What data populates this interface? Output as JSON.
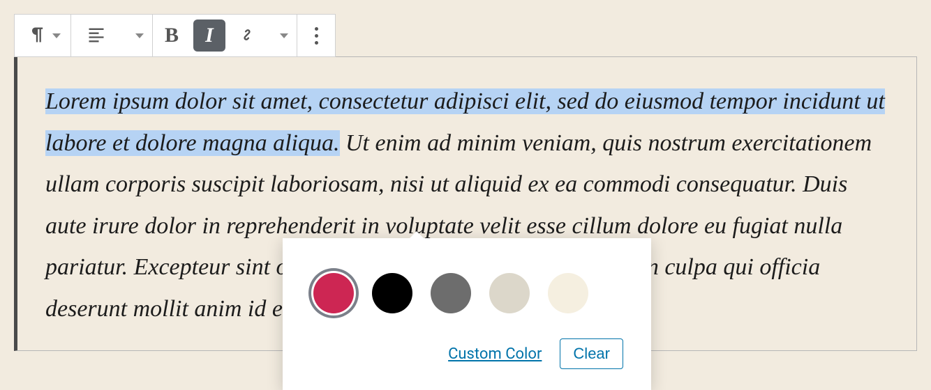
{
  "paragraph": {
    "highlighted": "Lorem ipsum dolor sit amet, consectetur adipisci elit, sed do eiusmod tempor incidunt ut labore et dolore magna aliqua.",
    "rest": " Ut enim ad minim veniam, quis nostrum exercitationem ullam corporis suscipit laboriosam, nisi ut aliquid ex ea commodi consequatur. Duis aute irure dolor in reprehenderit in voluptate velit esse cillum dolore eu fugiat nulla pariatur. Excepteur sint occaecat cupidatat non proident, sunt in culpa qui officia deserunt mollit anim id est laborum."
  },
  "toolbar": {
    "bold_label": "B",
    "italic_label": "I"
  },
  "color_popover": {
    "custom_label": "Custom Color",
    "clear_label": "Clear",
    "selected_index": 0,
    "swatches": [
      {
        "name": "rose",
        "hex": "#cd2653"
      },
      {
        "name": "black",
        "hex": "#000000"
      },
      {
        "name": "gray",
        "hex": "#6d6d6d"
      },
      {
        "name": "sand",
        "hex": "#dcd7ca"
      },
      {
        "name": "cream",
        "hex": "#f5efe0"
      }
    ]
  }
}
